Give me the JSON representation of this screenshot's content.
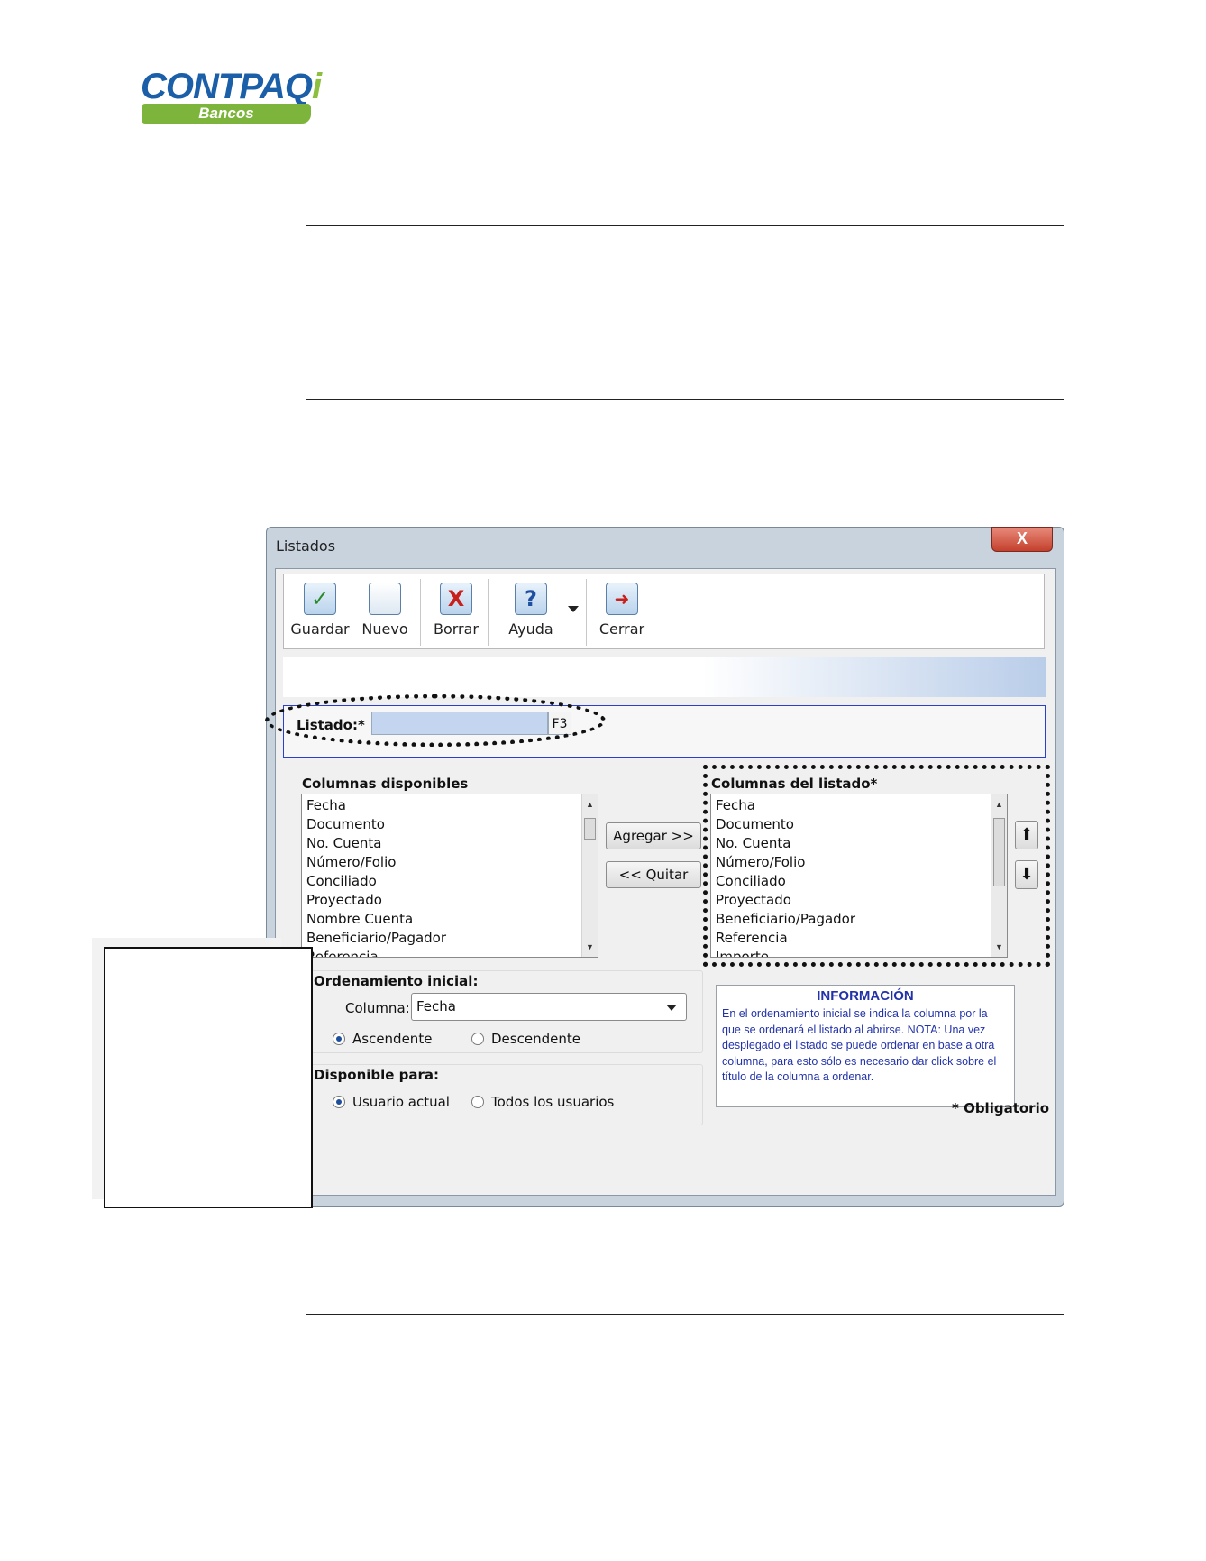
{
  "logo": {
    "brand": "CONTPAQ",
    "brand_i": "i",
    "product": "Bancos"
  },
  "window": {
    "title": "Listados",
    "close_symbol": "X"
  },
  "toolbar": {
    "guardar": "Guardar",
    "guardar_icon": "✓",
    "nuevo": "Nuevo",
    "borrar": "Borrar",
    "borrar_icon": "X",
    "ayuda": "Ayuda",
    "ayuda_icon": "?",
    "cerrar": "Cerrar",
    "cerrar_icon": "➜"
  },
  "listado": {
    "label": "Listado:",
    "required_mark": "*",
    "value": "",
    "key_hint": "F3"
  },
  "available": {
    "title": "Columnas disponibles",
    "items": [
      "Fecha",
      "Documento",
      "No. Cuenta",
      "Número/Folio",
      "Conciliado",
      "Proyectado",
      "Nombre Cuenta",
      "Beneficiario/Pagador",
      "Referencia"
    ]
  },
  "buttons": {
    "add": "Agregar >>",
    "remove": "<< Quitar",
    "up_icon": "⬆",
    "down_icon": "⬇"
  },
  "selected": {
    "title": "Columnas del listado",
    "required_mark": "*",
    "items": [
      "Fecha",
      "Documento",
      "No. Cuenta",
      "Número/Folio",
      "Conciliado",
      "Proyectado",
      "Beneficiario/Pagador",
      "Referencia",
      "Importe"
    ]
  },
  "ordering": {
    "title": "Ordenamiento inicial:",
    "column_label": "Columna:",
    "column_value": "Fecha",
    "asc": "Ascendente",
    "desc": "Descendente"
  },
  "availability": {
    "title": "Disponible para:",
    "current_user": "Usuario actual",
    "all_users": "Todos los usuarios"
  },
  "info": {
    "title": "INFORMACIÓN",
    "text": "En el ordenamiento inicial se indica la columna por la que se ordenará el listado al abrirse. NOTA: Una vez desplegado el listado se puede ordenar en base a otra columna, para esto sólo es necesario dar click sobre el título de la columna a ordenar."
  },
  "footer": {
    "required_note": "* Obligatorio"
  },
  "colors": {
    "brand_blue": "#1b5fa8",
    "brand_green": "#7db53c",
    "info_blue": "#2233aa",
    "highlight_border": "#2b3fcf"
  }
}
